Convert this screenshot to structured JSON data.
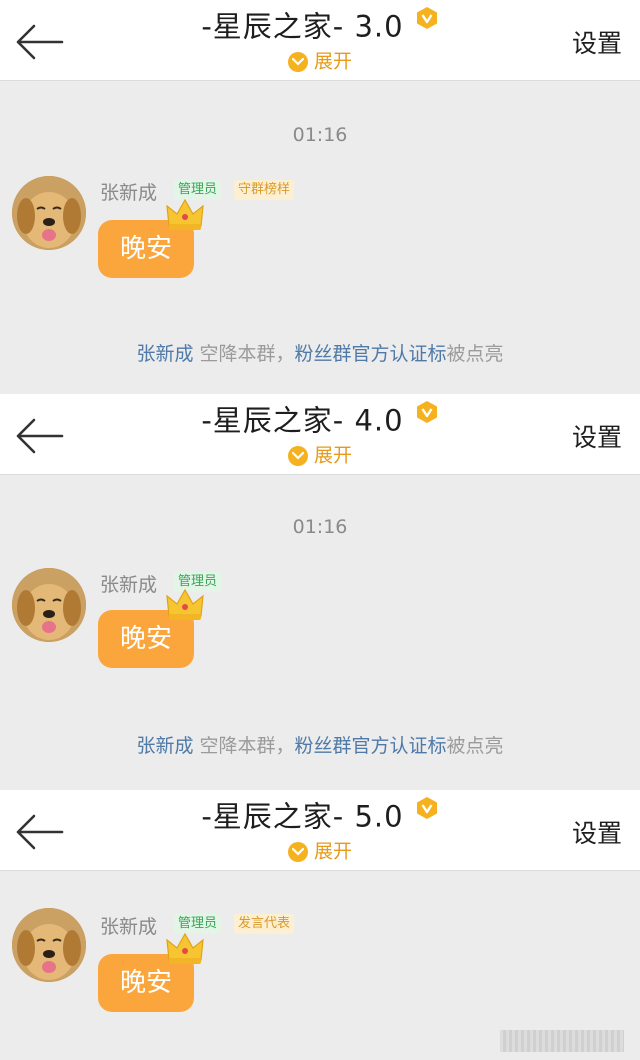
{
  "panels": [
    {
      "header": {
        "title": "-星辰之家- 3.0",
        "expand_label": "展开",
        "settings_label": "设置"
      },
      "time": "01:16",
      "message": {
        "username": "张新成",
        "badges": [
          "管理员",
          "守群榜样"
        ],
        "text": "晚安"
      },
      "system": {
        "name": "张新成",
        "action": " 空降本群，",
        "highlight": "粉丝群官方认证标",
        "suffix": "被点亮"
      }
    },
    {
      "header": {
        "title": "-星辰之家- 4.0",
        "expand_label": "展开",
        "settings_label": "设置"
      },
      "time": "01:16",
      "message": {
        "username": "张新成",
        "badges": [
          "管理员"
        ],
        "text": "晚安"
      },
      "system": {
        "name": "张新成",
        "action": " 空降本群，",
        "highlight": "粉丝群官方认证标",
        "suffix": "被点亮"
      }
    },
    {
      "header": {
        "title": "-星辰之家- 5.0",
        "expand_label": "展开",
        "settings_label": "设置"
      },
      "message": {
        "username": "张新成",
        "badges": [
          "管理员",
          "发言代表"
        ],
        "text": "晚安"
      }
    }
  ],
  "colors": {
    "bubble": "#fba63d",
    "accent_gold": "#f5b21e",
    "admin_badge_text": "#3aa457",
    "highlight_link": "#4f7aa8"
  },
  "icons": {
    "back": "back-arrow-icon",
    "verified": "v-badge-icon",
    "expand": "chevron-down-icon",
    "crown": "crown-icon"
  }
}
